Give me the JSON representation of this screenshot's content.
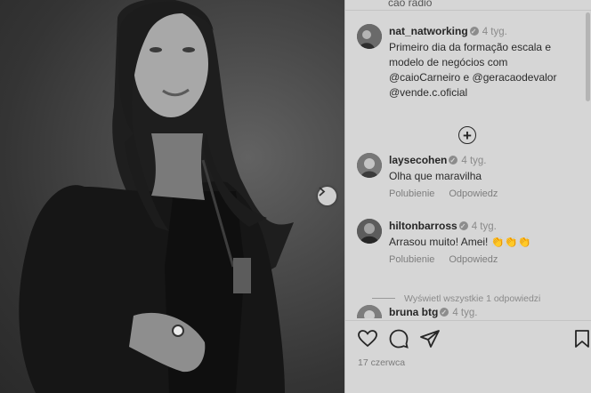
{
  "post": {
    "top_cut_text": "cao rádio",
    "caption": {
      "username": "nat_natworking",
      "time": "4 tyg.",
      "text": "Primeiro dia da formação escala e modelo de negócios com @caioCarneiro e @geracaodevalor @vende.c.oficial"
    }
  },
  "comments": [
    {
      "username": "laysecohen",
      "time": "4 tyg.",
      "text": "Olha que maravilha",
      "like": "Polubienie",
      "reply": "Odpowiedz"
    },
    {
      "username": "hiltonbarross",
      "time": "4 tyg.",
      "text": "Arrasou muito! Amei! 👏👏👏",
      "like": "Polubienie",
      "reply": "Odpowiedz"
    },
    {
      "username": "bruna btg",
      "time": "4 tyg."
    }
  ],
  "view_replies": "Wyświetl wszystkie 1 odpowiedzi",
  "date": "17 czerwca",
  "icons": [
    "heart-icon",
    "comment-icon",
    "share-icon",
    "bookmark-icon",
    "add-circle-icon",
    "chevron-right-icon"
  ]
}
